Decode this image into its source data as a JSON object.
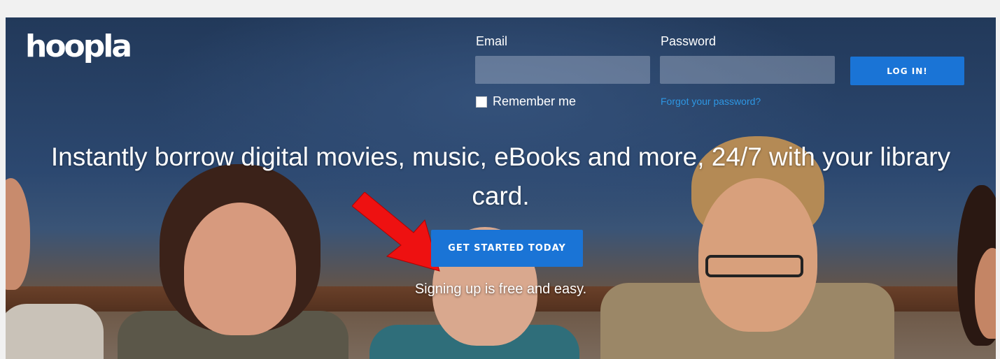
{
  "brand": {
    "logo_text": "hoopla"
  },
  "login": {
    "email_label": "Email",
    "email_value": "",
    "password_label": "Password",
    "password_value": "",
    "login_button": "LOG IN!",
    "remember_label": "Remember me",
    "remember_checked": false,
    "forgot_link": "Forgot your password?"
  },
  "hero": {
    "headline": "Instantly borrow digital movies, music, eBooks and more, 24/7 with your library card.",
    "cta_button": "GET STARTED TODAY",
    "subtext": "Signing up is free and easy."
  },
  "annotation": {
    "arrow_color": "#ee1111"
  },
  "colors": {
    "accent": "#1a74d6",
    "link": "#2e97e3"
  }
}
